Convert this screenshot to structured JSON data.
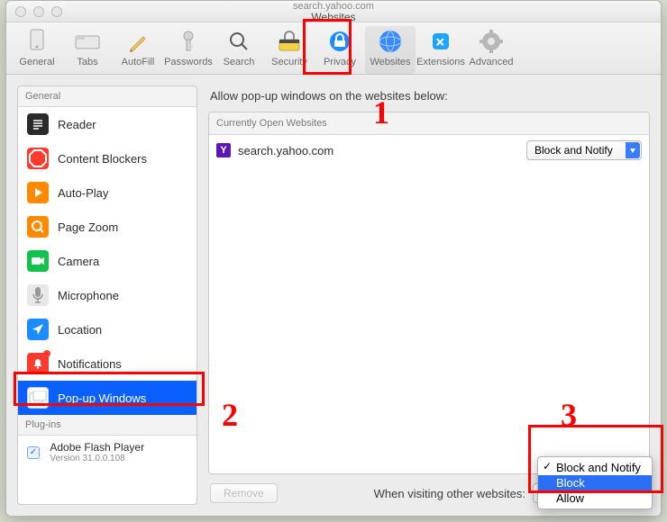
{
  "window": {
    "title_small": "search.yahoo.com",
    "title": "Websites"
  },
  "toolbar": [
    {
      "key": "general",
      "label": "General"
    },
    {
      "key": "tabs",
      "label": "Tabs"
    },
    {
      "key": "autofill",
      "label": "AutoFill"
    },
    {
      "key": "passwords",
      "label": "Passwords"
    },
    {
      "key": "search",
      "label": "Search"
    },
    {
      "key": "security",
      "label": "Security"
    },
    {
      "key": "privacy",
      "label": "Privacy"
    },
    {
      "key": "websites",
      "label": "Websites"
    },
    {
      "key": "extensions",
      "label": "Extensions"
    },
    {
      "key": "advanced",
      "label": "Advanced"
    }
  ],
  "toolbar_selected": "websites",
  "sidebar": {
    "header_general": "General",
    "header_plugins": "Plug-ins",
    "selected": "popups",
    "items": [
      {
        "key": "reader",
        "label": "Reader"
      },
      {
        "key": "contentblockers",
        "label": "Content Blockers"
      },
      {
        "key": "autoplay",
        "label": "Auto-Play"
      },
      {
        "key": "pagezoom",
        "label": "Page Zoom"
      },
      {
        "key": "camera",
        "label": "Camera"
      },
      {
        "key": "microphone",
        "label": "Microphone"
      },
      {
        "key": "location",
        "label": "Location"
      },
      {
        "key": "notifications",
        "label": "Notifications",
        "badge": true
      },
      {
        "key": "popups",
        "label": "Pop-up Windows"
      }
    ],
    "plugin": {
      "name": "Adobe Flash Player",
      "version": "Version 31.0.0.108",
      "checked": true
    }
  },
  "main": {
    "heading": "Allow pop-up windows on the websites below:",
    "list_header": "Currently Open Websites",
    "rows": [
      {
        "favicon": "Y",
        "site": "search.yahoo.com",
        "setting": "Block and Notify"
      }
    ],
    "remove_label": "Remove",
    "footer_label": "When visiting other websites:"
  },
  "dropdown": {
    "options": [
      "Block and Notify",
      "Block",
      "Allow"
    ],
    "checked": "Block and Notify",
    "highlighted": "Block"
  },
  "annotations": {
    "n1": "1",
    "n2": "2",
    "n3": "3"
  }
}
